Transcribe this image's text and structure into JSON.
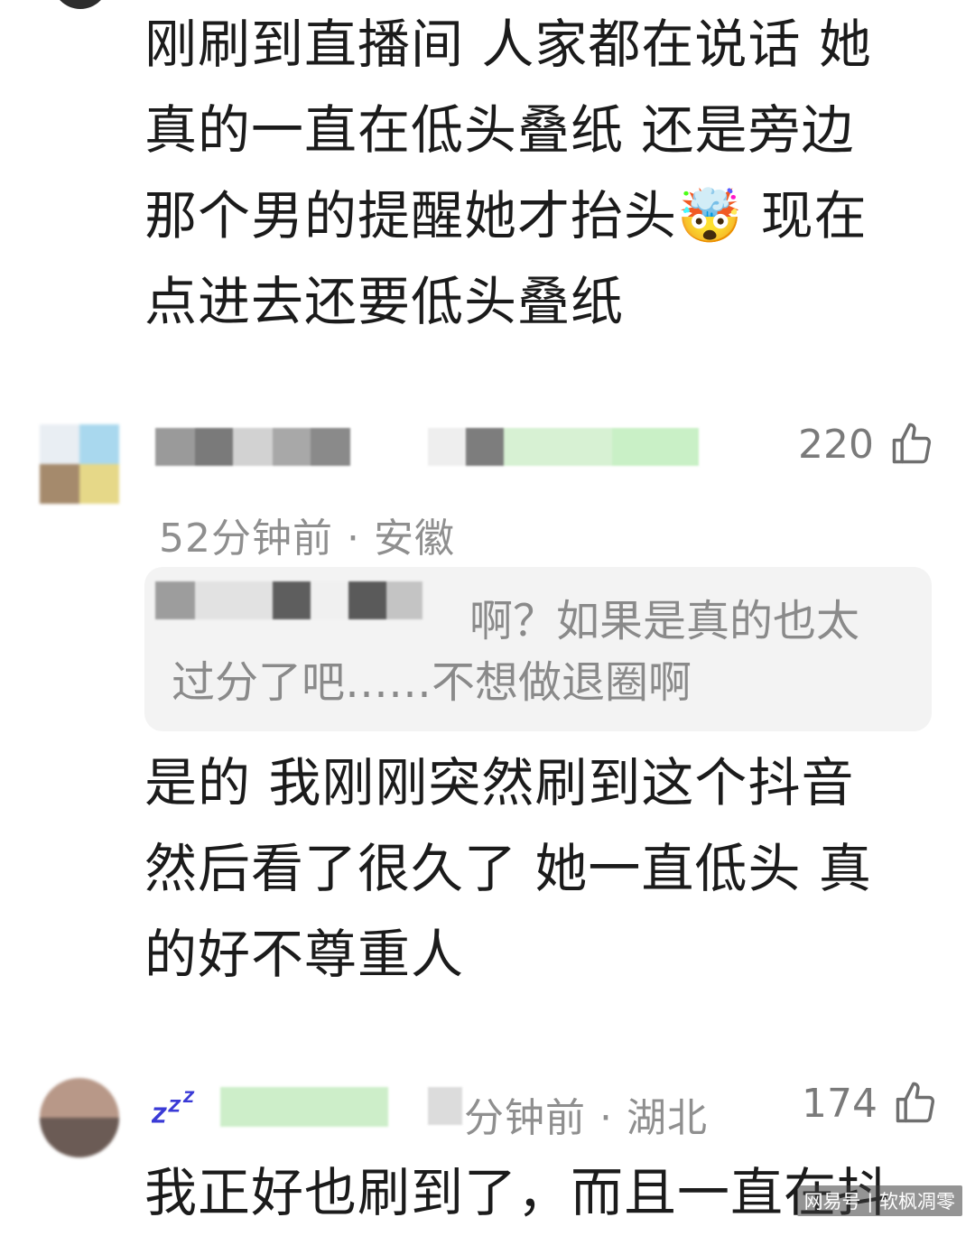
{
  "comment1": {
    "text": "刚刷到直播间 人家都在说话 她\n真的一直在低头叠纸 还是旁边\n那个男的提醒她才抬头🤯 现在\n点进去还要低头叠纸"
  },
  "comment2": {
    "likes": "220",
    "time_location": "52分钟前 · 安徽",
    "quote": "啊？如果是真的也太\n过分了吧……不想做退圈啊",
    "text": "是的 我刚刚突然刷到这个抖音\n然后看了很久了 她一直低头 真\n的好不尊重人"
  },
  "comment3": {
    "likes": "174",
    "time_location": "分钟前 · 湖北",
    "badge_icon": "zzz-icon",
    "text": "我正好也刷到了，而且一直在抖"
  },
  "watermark": "网易号 | 软枫凋零",
  "icons": {
    "like": "thumbs-up-icon"
  },
  "colors": {
    "text": "#1b1b1b",
    "meta": "#8f8f8f",
    "quote_bg": "#f3f3f3",
    "badge_green": "#c9f0c6"
  }
}
